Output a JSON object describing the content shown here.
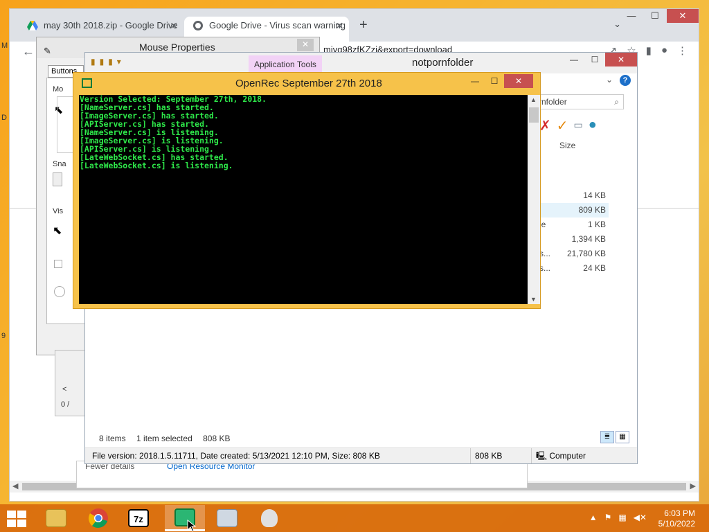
{
  "chrome": {
    "tabs": [
      {
        "label": "may 30th 2018.zip - Google Drive",
        "icon": "google-drive-icon"
      },
      {
        "label": "Google Drive - Virus scan warning",
        "icon": "globe-icon"
      }
    ],
    "new_tab": "+",
    "url_fragment": "miyg98zfKZzi&export=download",
    "side_letters": [
      "M",
      "D",
      "9"
    ]
  },
  "mouse_properties": {
    "title": "Mouse Properties",
    "tab": "Buttons",
    "labels": [
      "Mo",
      "Sna",
      "Vis"
    ]
  },
  "task_manager": {
    "value": "0 /",
    "footer_left": "Fewer details",
    "footer_link": "Open Resource Monitor"
  },
  "explorer": {
    "ribbon_tab": "Application Tools",
    "title": "notpornfolder",
    "search_text": "rnfolder",
    "size_header": "Size",
    "rows": [
      {
        "name": "",
        "size": "14 KB",
        "selected": false
      },
      {
        "name": "",
        "size": "809 KB",
        "selected": true
      },
      {
        "name": "le",
        "size": "1 KB",
        "selected": false
      },
      {
        "name": "",
        "size": "1,394 KB",
        "selected": false
      },
      {
        "name": "s...",
        "size": "21,780 KB",
        "selected": false
      },
      {
        "name": "s...",
        "size": "24 KB",
        "selected": false
      }
    ],
    "status_items": "8 items",
    "status_selected": "1 item selected",
    "status_size": "808 KB",
    "details": "File version: 2018.1.5.11711, Date created: 5/13/2021 12:10 PM, Size: 808 KB",
    "details_size": "808 KB",
    "details_location": "Computer"
  },
  "console": {
    "title": "OpenRec September 27th 2018",
    "lines": [
      "Version Selected: September 27th, 2018.",
      "[NameServer.cs] has started.",
      "[ImageServer.cs] has started.",
      "[APIServer.cs] has started.",
      "[NameServer.cs] is listening.",
      "[ImageServer.cs] is listening.",
      "[APIServer.cs] is listening.",
      "[LateWebSocket.cs] has started.",
      "[LateWebSocket.cs] is listening."
    ]
  },
  "taskbar": {
    "apps": [
      {
        "name": "file-explorer",
        "label": ""
      },
      {
        "name": "chrome",
        "label": ""
      },
      {
        "name": "7zip",
        "label": "7z"
      },
      {
        "name": "openrec",
        "label": "",
        "active": true
      },
      {
        "name": "performance-monitor",
        "label": ""
      },
      {
        "name": "mouse",
        "label": ""
      }
    ],
    "time": "6:03 PM",
    "date": "5/10/2022"
  },
  "colors": {
    "console_text": "#2ee84a",
    "console_bg": "#000000",
    "taskbar": "#d86a0c",
    "close_button": "#c75050",
    "app_tools": "#f2d2f6"
  }
}
